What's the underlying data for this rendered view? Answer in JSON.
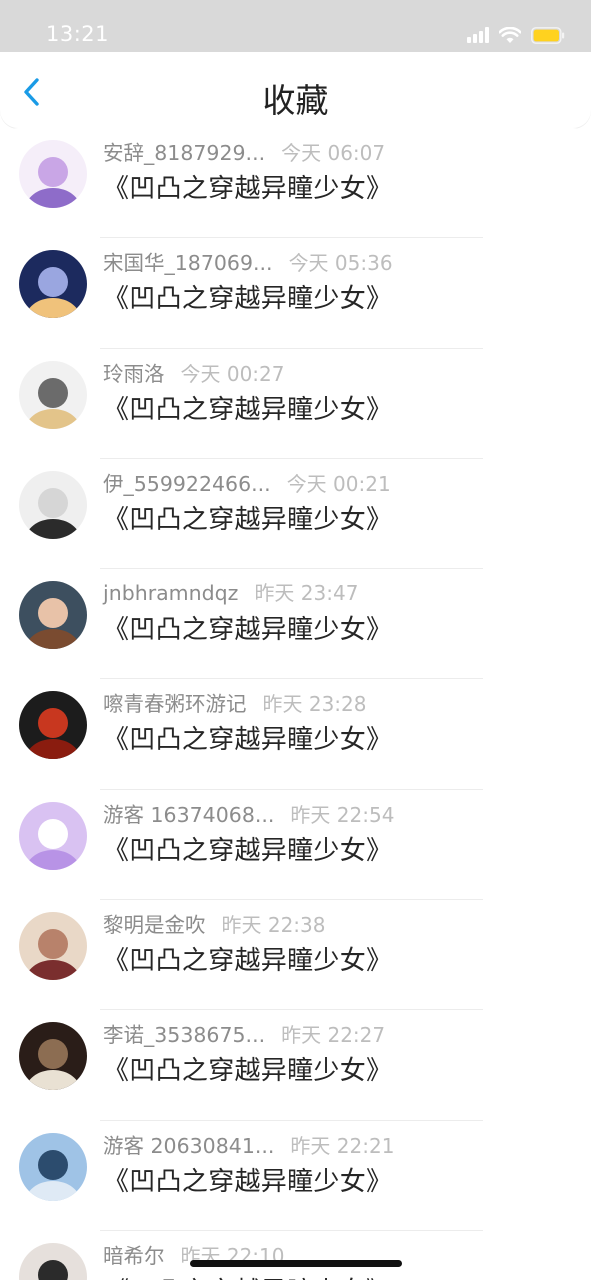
{
  "status_bar": {
    "time": "13:21",
    "colors": {
      "bar_bg": "#d9d9d9",
      "battery": "#ffd21f"
    }
  },
  "header": {
    "title": "收藏",
    "back_icon": "chevron-left-icon",
    "accent": "#1a9be6"
  },
  "list": {
    "items": [
      {
        "name": "安辞_8187929...",
        "time": "今天 06:07",
        "book": "《凹凸之穿越异瞳少女》",
        "avatar_colors": [
          "#f5eef9",
          "#c9a6e6",
          "#8e6cc9"
        ]
      },
      {
        "name": "宋国华_187069...",
        "time": "今天 05:36",
        "book": "《凹凸之穿越异瞳少女》",
        "avatar_colors": [
          "#1c2a5e",
          "#9aa6e0",
          "#f0c27b"
        ]
      },
      {
        "name": "玲雨洛",
        "time": "今天 00:27",
        "book": "《凹凸之穿越异瞳少女》",
        "avatar_colors": [
          "#f1f1f1",
          "#6b6b6b",
          "#e3c48a"
        ]
      },
      {
        "name": "伊_559922466...",
        "time": "今天 00:21",
        "book": "《凹凸之穿越异瞳少女》",
        "avatar_colors": [
          "#efefef",
          "#d6d6d6",
          "#2b2b2b"
        ]
      },
      {
        "name": "jnbhramndqz",
        "time": "昨天 23:47",
        "book": "《凹凸之穿越异瞳少女》",
        "avatar_colors": [
          "#3d4f5f",
          "#e8c2a8",
          "#7a4b30"
        ]
      },
      {
        "name": "嚓青春粥环游记",
        "time": "昨天 23:28",
        "book": "《凹凸之穿越异瞳少女》",
        "avatar_colors": [
          "#1c1c1c",
          "#c8371f",
          "#8a1c0f"
        ]
      },
      {
        "name": "游客 16374068...",
        "time": "昨天 22:54",
        "book": "《凹凸之穿越异瞳少女》",
        "avatar_colors": [
          "#d9c2f2",
          "#ffffff",
          "#b893e6"
        ]
      },
      {
        "name": "黎明是金吹",
        "time": "昨天 22:38",
        "book": "《凹凸之穿越异瞳少女》",
        "avatar_colors": [
          "#e9d8c7",
          "#b8826b",
          "#7a2e2e"
        ]
      },
      {
        "name": "李诺_3538675...",
        "time": "昨天 22:27",
        "book": "《凹凸之穿越异瞳少女》",
        "avatar_colors": [
          "#2a1d18",
          "#8c6d52",
          "#e9e1d3"
        ]
      },
      {
        "name": "游客 20630841...",
        "time": "昨天 22:21",
        "book": "《凹凸之穿越异瞳少女》",
        "avatar_colors": [
          "#9fc3e6",
          "#2c4c6e",
          "#dfeaf5"
        ]
      },
      {
        "name": "暗希尔",
        "time": "昨天 22:10",
        "book": "《凹凸之穿越异瞳少女》",
        "avatar_colors": [
          "#e6e0dc",
          "#2b2b2b",
          "#8c7bd1"
        ]
      }
    ]
  }
}
